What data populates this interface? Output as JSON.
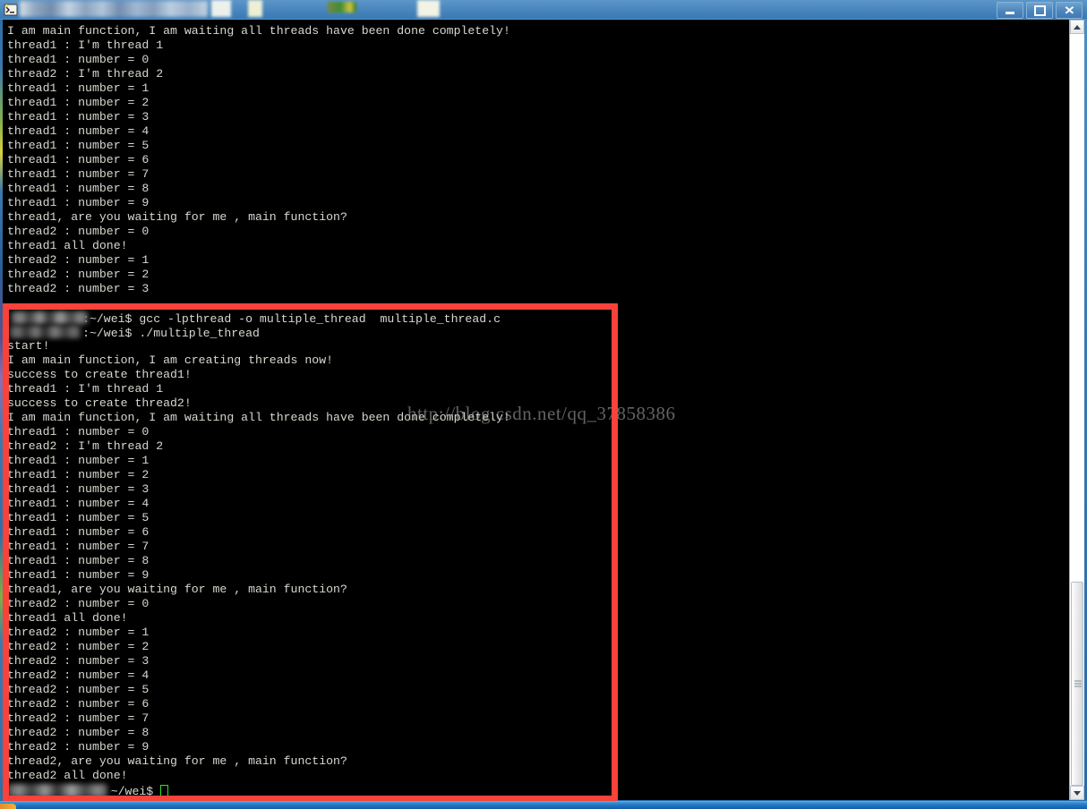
{
  "window": {
    "title_redacted": true,
    "controls": {
      "minimize_label": "Minimize",
      "maximize_label": "Maximize",
      "close_label": "Close"
    }
  },
  "terminal": {
    "prompt_path": ":~/wei$",
    "prompt_path_short": "~/wei$",
    "commands": {
      "compile": "gcc -lpthread -o multiple_thread  multiple_thread.c",
      "run": "./multiple_thread"
    },
    "upper_output": [
      "I am main function, I am waiting all threads have been done completely!",
      "thread1 : I'm thread 1",
      "thread1 : number = 0",
      "thread2 : I'm thread 2",
      "thread1 : number = 1",
      "thread1 : number = 2",
      "thread1 : number = 3",
      "thread1 : number = 4",
      "thread1 : number = 5",
      "thread1 : number = 6",
      "thread1 : number = 7",
      "thread1 : number = 8",
      "thread1 : number = 9",
      "thread1, are you waiting for me , main function?",
      "thread2 : number = 0",
      "thread1 all done!",
      "thread2 : number = 1",
      "thread2 : number = 2",
      "thread2 : number = 3"
    ],
    "lower_output": [
      "start!",
      "I am main function, I am creating threads now!",
      "success to create thread1!",
      "thread1 : I'm thread 1",
      "success to create thread2!",
      "I am main function, I am waiting all threads have been done completely!",
      "thread1 : number = 0",
      "thread2 : I'm thread 2",
      "thread1 : number = 1",
      "thread1 : number = 2",
      "thread1 : number = 3",
      "thread1 : number = 4",
      "thread1 : number = 5",
      "thread1 : number = 6",
      "thread1 : number = 7",
      "thread1 : number = 8",
      "thread1 : number = 9",
      "thread1, are you waiting for me , main function?",
      "thread2 : number = 0",
      "thread1 all done!",
      "thread2 : number = 1",
      "thread2 : number = 2",
      "thread2 : number = 3",
      "thread2 : number = 4",
      "thread2 : number = 5",
      "thread2 : number = 6",
      "thread2 : number = 7",
      "thread2 : number = 8",
      "thread2 : number = 9",
      "thread2, are you waiting for me , main function?",
      "thread2 all done!"
    ]
  },
  "watermark": {
    "text": "http://blog.csdn.net/qq_37858386"
  },
  "annotation": {
    "type": "red-rectangle",
    "color": "#f9423a"
  },
  "scrollbar": {
    "up_arrow": "▲",
    "down_arrow": "▼"
  },
  "colors": {
    "terminal_bg": "#000000",
    "terminal_fg": "#d8d8d0",
    "cursor": "#2ee02e",
    "annotation_red": "#f9423a",
    "title_bar": "#4b88bf"
  }
}
